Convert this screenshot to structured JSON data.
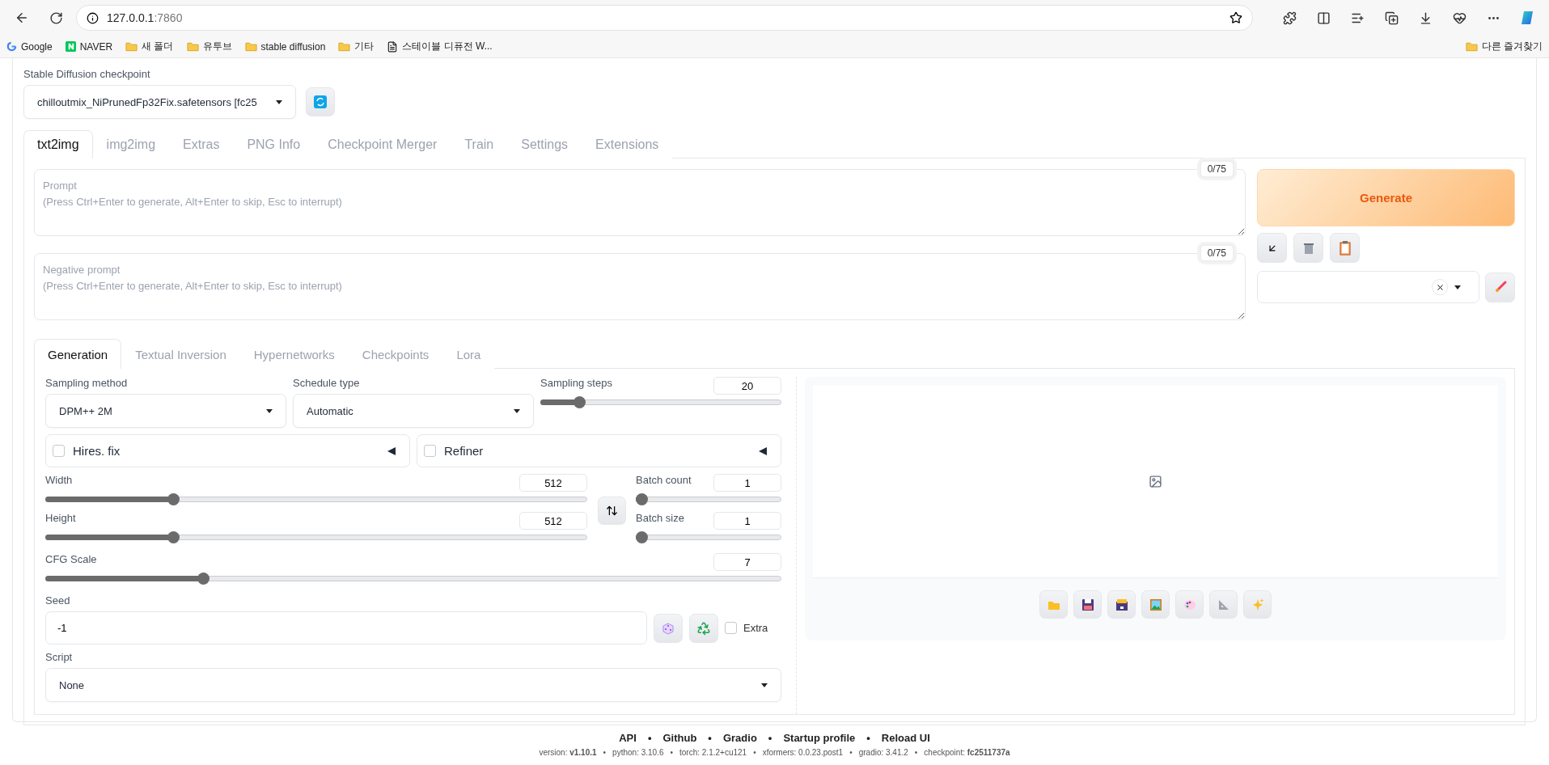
{
  "browser": {
    "url_host": "127.0.0.1",
    "url_port": ":7860",
    "bookmarks": [
      {
        "label": "Google",
        "kind": "google"
      },
      {
        "label": "NAVER",
        "kind": "naver"
      },
      {
        "label": "새 폴더",
        "kind": "folder"
      },
      {
        "label": "유투브",
        "kind": "folder"
      },
      {
        "label": "stable diffusion",
        "kind": "folder"
      },
      {
        "label": "기타",
        "kind": "folder"
      },
      {
        "label": "스테이블 디퓨전 W...",
        "kind": "page"
      }
    ],
    "other_bookmarks": "다른 즐겨찾기"
  },
  "checkpoint": {
    "label": "Stable Diffusion checkpoint",
    "value": "chilloutmix_NiPrunedFp32Fix.safetensors [fc25"
  },
  "tabs": [
    {
      "label": "txt2img",
      "selected": true
    },
    {
      "label": "img2img",
      "selected": false
    },
    {
      "label": "Extras",
      "selected": false
    },
    {
      "label": "PNG Info",
      "selected": false
    },
    {
      "label": "Checkpoint Merger",
      "selected": false
    },
    {
      "label": "Train",
      "selected": false
    },
    {
      "label": "Settings",
      "selected": false
    },
    {
      "label": "Extensions",
      "selected": false
    }
  ],
  "prompts": [
    {
      "placeholder": "Prompt\n(Press Ctrl+Enter to generate, Alt+Enter to skip, Esc to interrupt)",
      "counter": "0/75"
    },
    {
      "placeholder": "Negative prompt\n(Press Ctrl+Enter to generate, Alt+Enter to skip, Esc to interrupt)",
      "counter": "0/75"
    }
  ],
  "generate_button": "Generate",
  "sub_tabs": [
    {
      "label": "Generation",
      "selected": true
    },
    {
      "label": "Textual Inversion",
      "selected": false
    },
    {
      "label": "Hypernetworks",
      "selected": false
    },
    {
      "label": "Checkpoints",
      "selected": false
    },
    {
      "label": "Lora",
      "selected": false
    }
  ],
  "sampling_method": {
    "label": "Sampling method",
    "value": "DPM++ 2M"
  },
  "schedule_type": {
    "label": "Schedule type",
    "value": "Automatic"
  },
  "sampling_steps": {
    "label": "Sampling steps",
    "value": "20",
    "level": 0.144
  },
  "accordions": [
    {
      "label": "Hires. fix",
      "checked": false
    },
    {
      "label": "Refiner",
      "checked": false
    }
  ],
  "width": {
    "label": "Width",
    "value": "512",
    "level": 0.23
  },
  "height": {
    "label": "Height",
    "value": "512",
    "level": 0.23
  },
  "batch_count": {
    "label": "Batch count",
    "value": "1",
    "level": 0
  },
  "batch_size": {
    "label": "Batch size",
    "value": "1",
    "level": 0
  },
  "cfg_scale": {
    "label": "CFG Scale",
    "value": "7",
    "level": 0.21
  },
  "seed": {
    "label": "Seed",
    "value": "-1"
  },
  "extra": {
    "label": "Extra",
    "checked": false
  },
  "script": {
    "label": "Script",
    "value": "None"
  },
  "footer": {
    "separator": "•",
    "links": [
      "API",
      "Github",
      "Gradio",
      "Startup profile",
      "Reload UI"
    ],
    "versions": [
      "version: **v1.10.1**",
      "python: 3.10.6",
      "torch: 2.1.2+cu121",
      "xformers: 0.0.23.post1",
      "gradio: 3.41.2",
      "checkpoint: **fc2511737a**"
    ]
  }
}
